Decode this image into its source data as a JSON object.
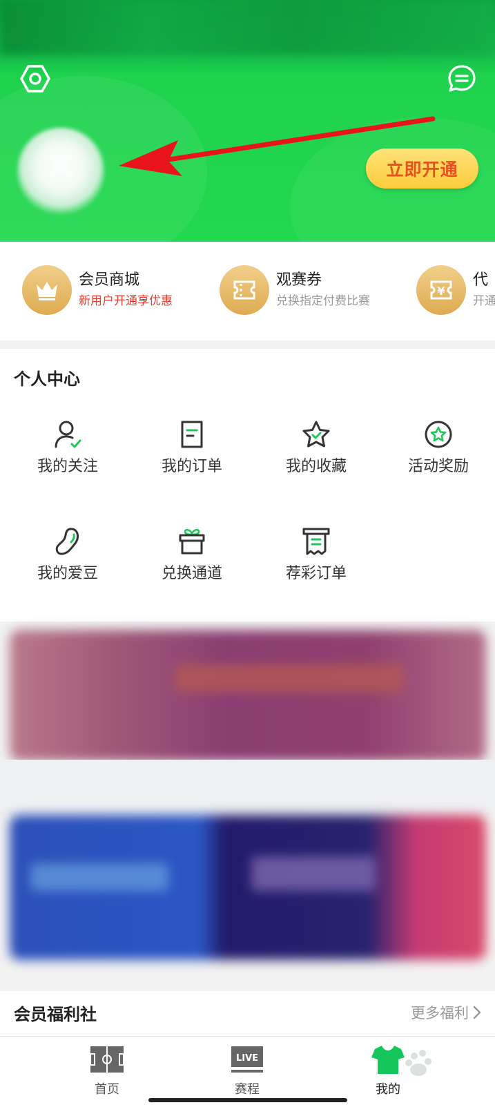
{
  "header": {
    "open_button_label": "立即开通",
    "colors": {
      "green": "#22d84f",
      "button_text": "#e6521e",
      "button_bg": "#fccd3a"
    }
  },
  "member_strip": {
    "items": [
      {
        "title": "会员商城",
        "subtitle": "新用户开通享优惠",
        "icon": "crown-icon"
      },
      {
        "title": "观赛券",
        "subtitle": "兑换指定付费比赛",
        "icon": "ticket-icon"
      },
      {
        "title": "代",
        "subtitle": "开通",
        "icon": "yuan-coupon-icon"
      }
    ]
  },
  "personal_center": {
    "title": "个人中心",
    "items": [
      {
        "label": "我的关注",
        "icon": "user-check-icon"
      },
      {
        "label": "我的订单",
        "icon": "order-icon"
      },
      {
        "label": "我的收藏",
        "icon": "star-icon"
      },
      {
        "label": "活动奖励",
        "icon": "badge-star-icon"
      },
      {
        "label": "我的爱豆",
        "icon": "bean-icon"
      },
      {
        "label": "兑换通道",
        "icon": "gift-icon"
      },
      {
        "label": "荐彩订单",
        "icon": "receipt-icon"
      }
    ]
  },
  "welfare": {
    "title": "会员福利社",
    "more_label": "更多福利"
  },
  "tabbar": {
    "items": [
      {
        "label": "首页",
        "icon": "pitch-icon"
      },
      {
        "label": "赛程",
        "icon": "live-icon",
        "badge": "LIVE"
      },
      {
        "label": "我的",
        "icon": "jersey-icon",
        "active": true
      }
    ]
  }
}
